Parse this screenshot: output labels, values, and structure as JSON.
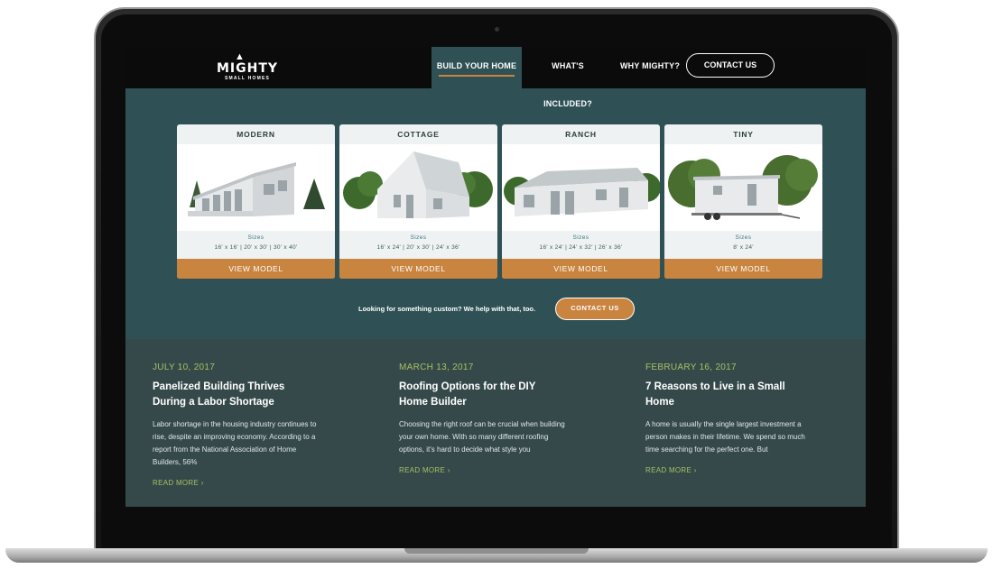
{
  "brand": {
    "name": "MIGHTY",
    "tagline": "SMALL HOMES"
  },
  "nav": {
    "items": [
      {
        "label": "BUILD YOUR HOME",
        "active": true
      },
      {
        "label": "WHAT'S INCLUDED?",
        "active": false
      },
      {
        "label": "WHY MIGHTY?",
        "active": false
      }
    ],
    "contact": "CONTACT US"
  },
  "models": [
    {
      "name": "MODERN",
      "sizes_label": "Sizes",
      "sizes": "16' x 16' | 20' x 30' | 30' x 40'",
      "button": "VIEW MODEL",
      "icon": "modern-house-image"
    },
    {
      "name": "COTTAGE",
      "sizes_label": "Sizes",
      "sizes": "16' x 24' | 20' x 30' | 24' x 36'",
      "button": "VIEW MODEL",
      "icon": "cottage-house-image"
    },
    {
      "name": "RANCH",
      "sizes_label": "Sizes",
      "sizes": "16' x 24' | 24' x 32' | 26' x 36'",
      "button": "VIEW MODEL",
      "icon": "ranch-house-image"
    },
    {
      "name": "TINY",
      "sizes_label": "Sizes",
      "sizes": "8' x 24'",
      "button": "VIEW MODEL",
      "icon": "tiny-house-image"
    }
  ],
  "custom": {
    "text": "Looking for something custom? We help with that, too.",
    "button": "CONTACT US"
  },
  "posts": [
    {
      "date": "JULY 10, 2017",
      "title": "Panelized Building Thrives During a Labor Shortage",
      "excerpt": "Labor shortage in the housing industry continues to rise, despite an improving economy. According to a report from the National Association of Home Builders, 56%",
      "more": "READ MORE"
    },
    {
      "date": "MARCH 13, 2017",
      "title": "Roofing Options for the DIY Home Builder",
      "excerpt": "Choosing the right roof can be crucial when building your own home. With so many different roofing options, it's hard to decide what style you",
      "more": "READ MORE"
    },
    {
      "date": "FEBRUARY 16, 2017",
      "title": "7 Reasons to Live in a Small Home",
      "excerpt": "A home is usually the single largest investment a person makes in their lifetime. We spend so much time searching for the perfect one. But",
      "more": "READ MORE"
    }
  ],
  "colors": {
    "nav_bg": "#0b0b0b",
    "hero_bg": "#2f5155",
    "blog_bg": "#36494a",
    "accent_orange": "#c9843f",
    "accent_green": "#a3c163"
  }
}
